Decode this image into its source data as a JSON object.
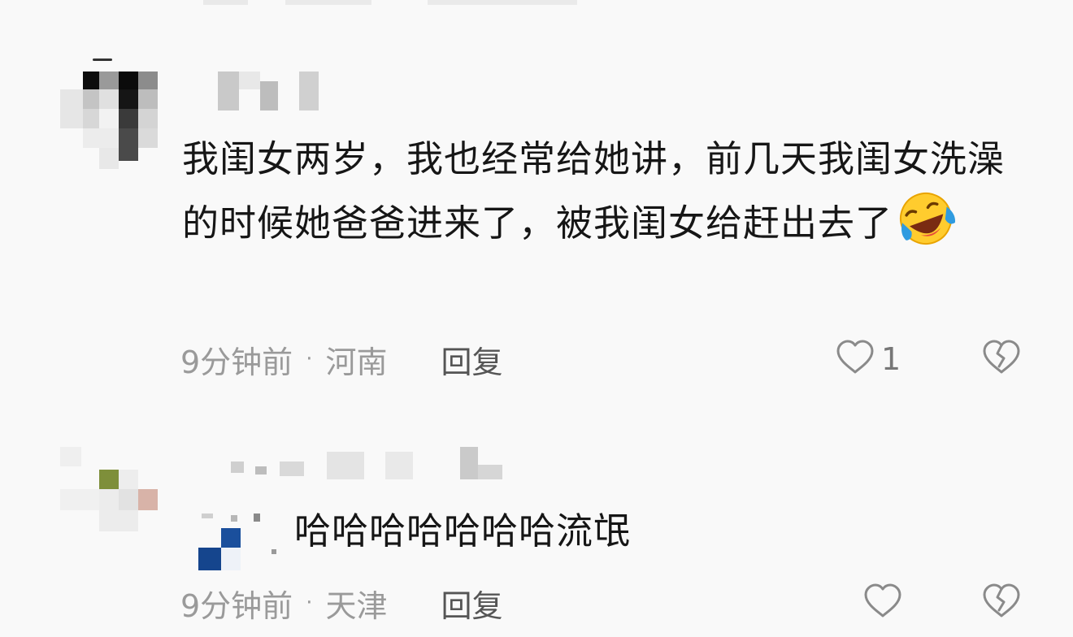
{
  "comments": [
    {
      "text": "我闺女两岁，我也经常给她讲，前几天我闺女洗澡的时候她爸爸进来了，被我闺女给赶出去了",
      "emoji": "rolling-on-floor-laughing",
      "time": "9分钟前",
      "separator": "·",
      "location": "河南",
      "reply_label": "回复",
      "like_count": "1"
    },
    {
      "text": "哈哈哈哈哈哈哈流氓",
      "time": "9分钟前",
      "separator": "·",
      "location": "天津",
      "reply_label": "回复"
    }
  ],
  "colors": {
    "background": "#f9f9f9",
    "text": "#161616",
    "meta": "#9a9a9a",
    "icon": "#8a8a8a"
  }
}
